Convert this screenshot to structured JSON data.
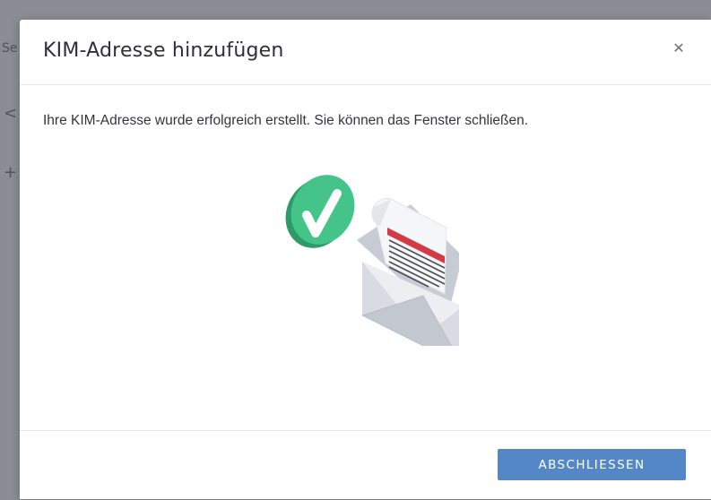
{
  "dialog": {
    "title": "KIM-Adresse hinzufügen",
    "close_icon": "close-icon",
    "message": "Ihre KIM-Adresse wurde erfolgreich erstellt. Sie können das Fenster schließen.",
    "illustration": "success-envelope-illustration",
    "primary_button_label": "ABSCHLIESSEN"
  },
  "background": {
    "fragments": [
      "Se",
      "<",
      "+"
    ]
  },
  "colors": {
    "overlay": "#8a8d93",
    "primary_button": "#5487c5",
    "success_badge": "#3fbf84",
    "envelope": "#d6d9e0",
    "letter_accent": "#d23a45"
  }
}
